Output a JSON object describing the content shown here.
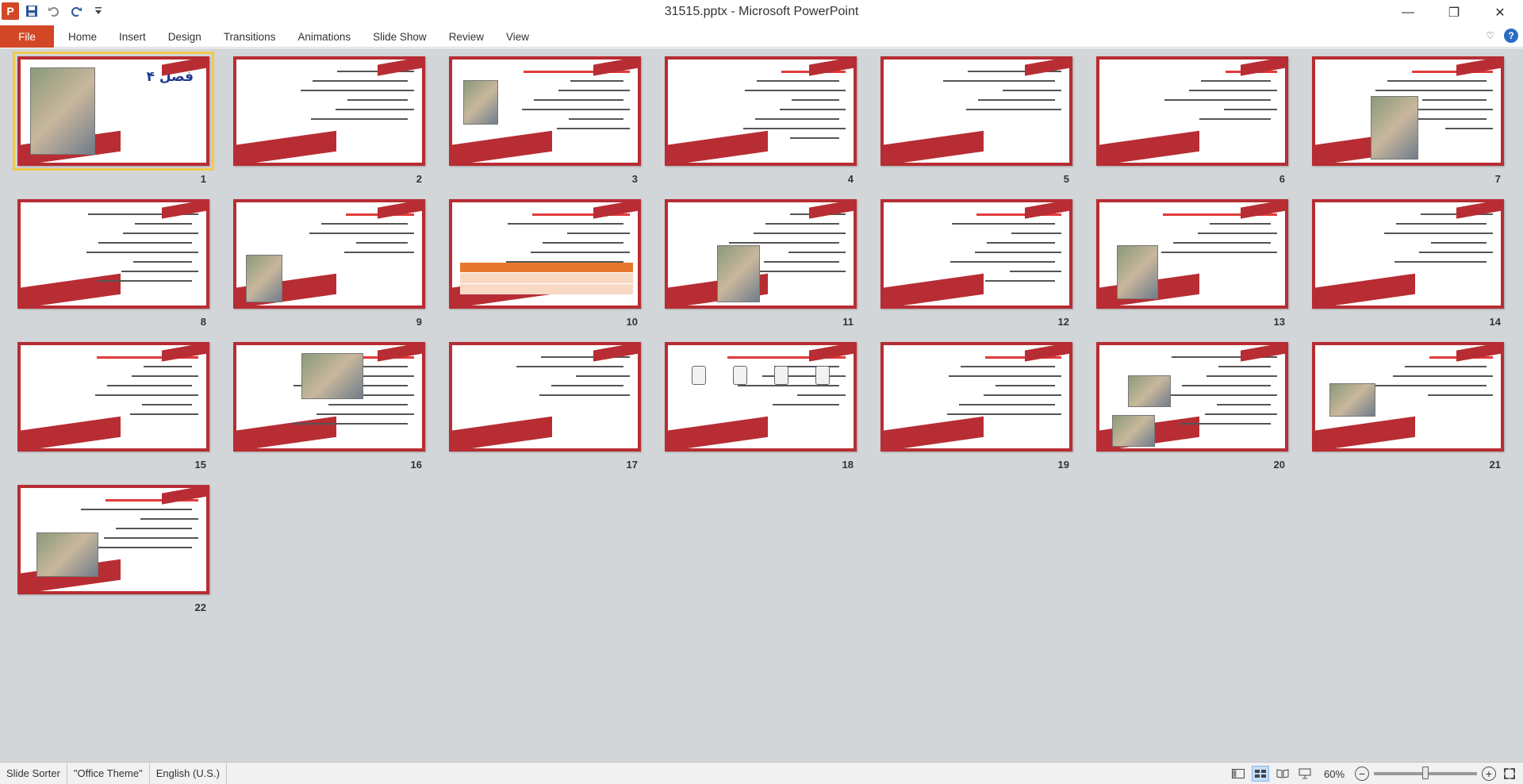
{
  "window": {
    "title": "31515.pptx  -  Microsoft PowerPoint",
    "app_icon": "P",
    "controls": {
      "minimize": "—",
      "restore": "❐",
      "close": "✕"
    }
  },
  "quick_access": {
    "icons": [
      "save-icon",
      "undo-icon",
      "redo-icon",
      "customize-icon"
    ]
  },
  "ribbon": {
    "tabs": [
      "File",
      "Home",
      "Insert",
      "Design",
      "Transitions",
      "Animations",
      "Slide Show",
      "Review",
      "View"
    ],
    "help": "?",
    "minimize_icon": "♡"
  },
  "slides": [
    {
      "number": "1",
      "heading": "فصل ۴"
    },
    {
      "number": "2"
    },
    {
      "number": "3"
    },
    {
      "number": "4"
    },
    {
      "number": "5"
    },
    {
      "number": "6"
    },
    {
      "number": "7"
    },
    {
      "number": "8"
    },
    {
      "number": "9"
    },
    {
      "number": "10"
    },
    {
      "number": "11"
    },
    {
      "number": "12"
    },
    {
      "number": "13"
    },
    {
      "number": "14"
    },
    {
      "number": "15"
    },
    {
      "number": "16"
    },
    {
      "number": "17"
    },
    {
      "number": "18"
    },
    {
      "number": "19"
    },
    {
      "number": "20"
    },
    {
      "number": "21"
    },
    {
      "number": "22"
    }
  ],
  "selected_slide": "1",
  "status": {
    "view": "Slide Sorter",
    "theme": "\"Office Theme\"",
    "language": "English (U.S.)",
    "zoom": "60%",
    "zoom_out": "−",
    "zoom_in": "+",
    "zoom_fraction": 0.5
  },
  "colors": {
    "accent": "#d24726",
    "slide_border": "#b72d33",
    "selection": "#f2c94c",
    "background": "#d3d6d9"
  }
}
